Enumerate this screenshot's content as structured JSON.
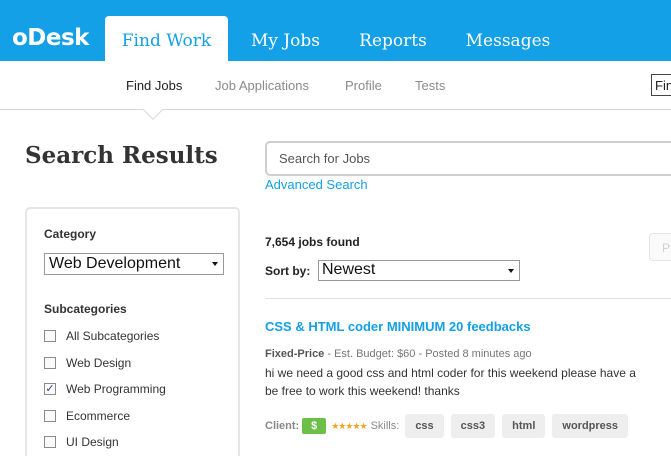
{
  "header": {
    "logo": "oDesk",
    "tabs": [
      {
        "label": "Find Work"
      },
      {
        "label": "My Jobs"
      },
      {
        "label": "Reports"
      },
      {
        "label": "Messages"
      }
    ]
  },
  "subnav": {
    "items": [
      {
        "label": "Find Jobs"
      },
      {
        "label": "Job Applications"
      },
      {
        "label": "Profile"
      },
      {
        "label": "Tests"
      }
    ],
    "truncated_box": "Fin"
  },
  "page_title": "Search Results",
  "search": {
    "placeholder": "Search for Jobs",
    "advanced_link": "Advanced Search"
  },
  "sidebar": {
    "category_heading": "Category",
    "category_value": "Web Development",
    "subcategories_heading": "Subcategories",
    "subcategories": [
      {
        "label": "All Subcategories",
        "checked": false
      },
      {
        "label": "Web Design",
        "checked": false
      },
      {
        "label": "Web Programming",
        "checked": true
      },
      {
        "label": "Ecommerce",
        "checked": false
      },
      {
        "label": "UI Design",
        "checked": false
      }
    ]
  },
  "results": {
    "count_text": "7,654 jobs found",
    "sort_label": "Sort by:",
    "sort_value": "Newest",
    "faded_button": "Pr"
  },
  "job": {
    "title": "CSS & HTML coder MINIMUM 20 feedbacks",
    "type": "Fixed-Price",
    "meta": " - Est. Budget: $60 - Posted 8 minutes ago",
    "desc_line1": "hi we need a good css and html coder for this weekend please have a",
    "desc_line2": "be free to work this weekend! thanks",
    "client_label": "Client:",
    "client_badge": "$",
    "stars": "★★★★★",
    "skills_label": "Skills:",
    "skills": [
      "css",
      "css3",
      "html",
      "wordpress"
    ]
  },
  "colors": {
    "brand_blue": "#13a0e6",
    "verified_green": "#6cc04a",
    "star_gold": "#f5a623"
  }
}
